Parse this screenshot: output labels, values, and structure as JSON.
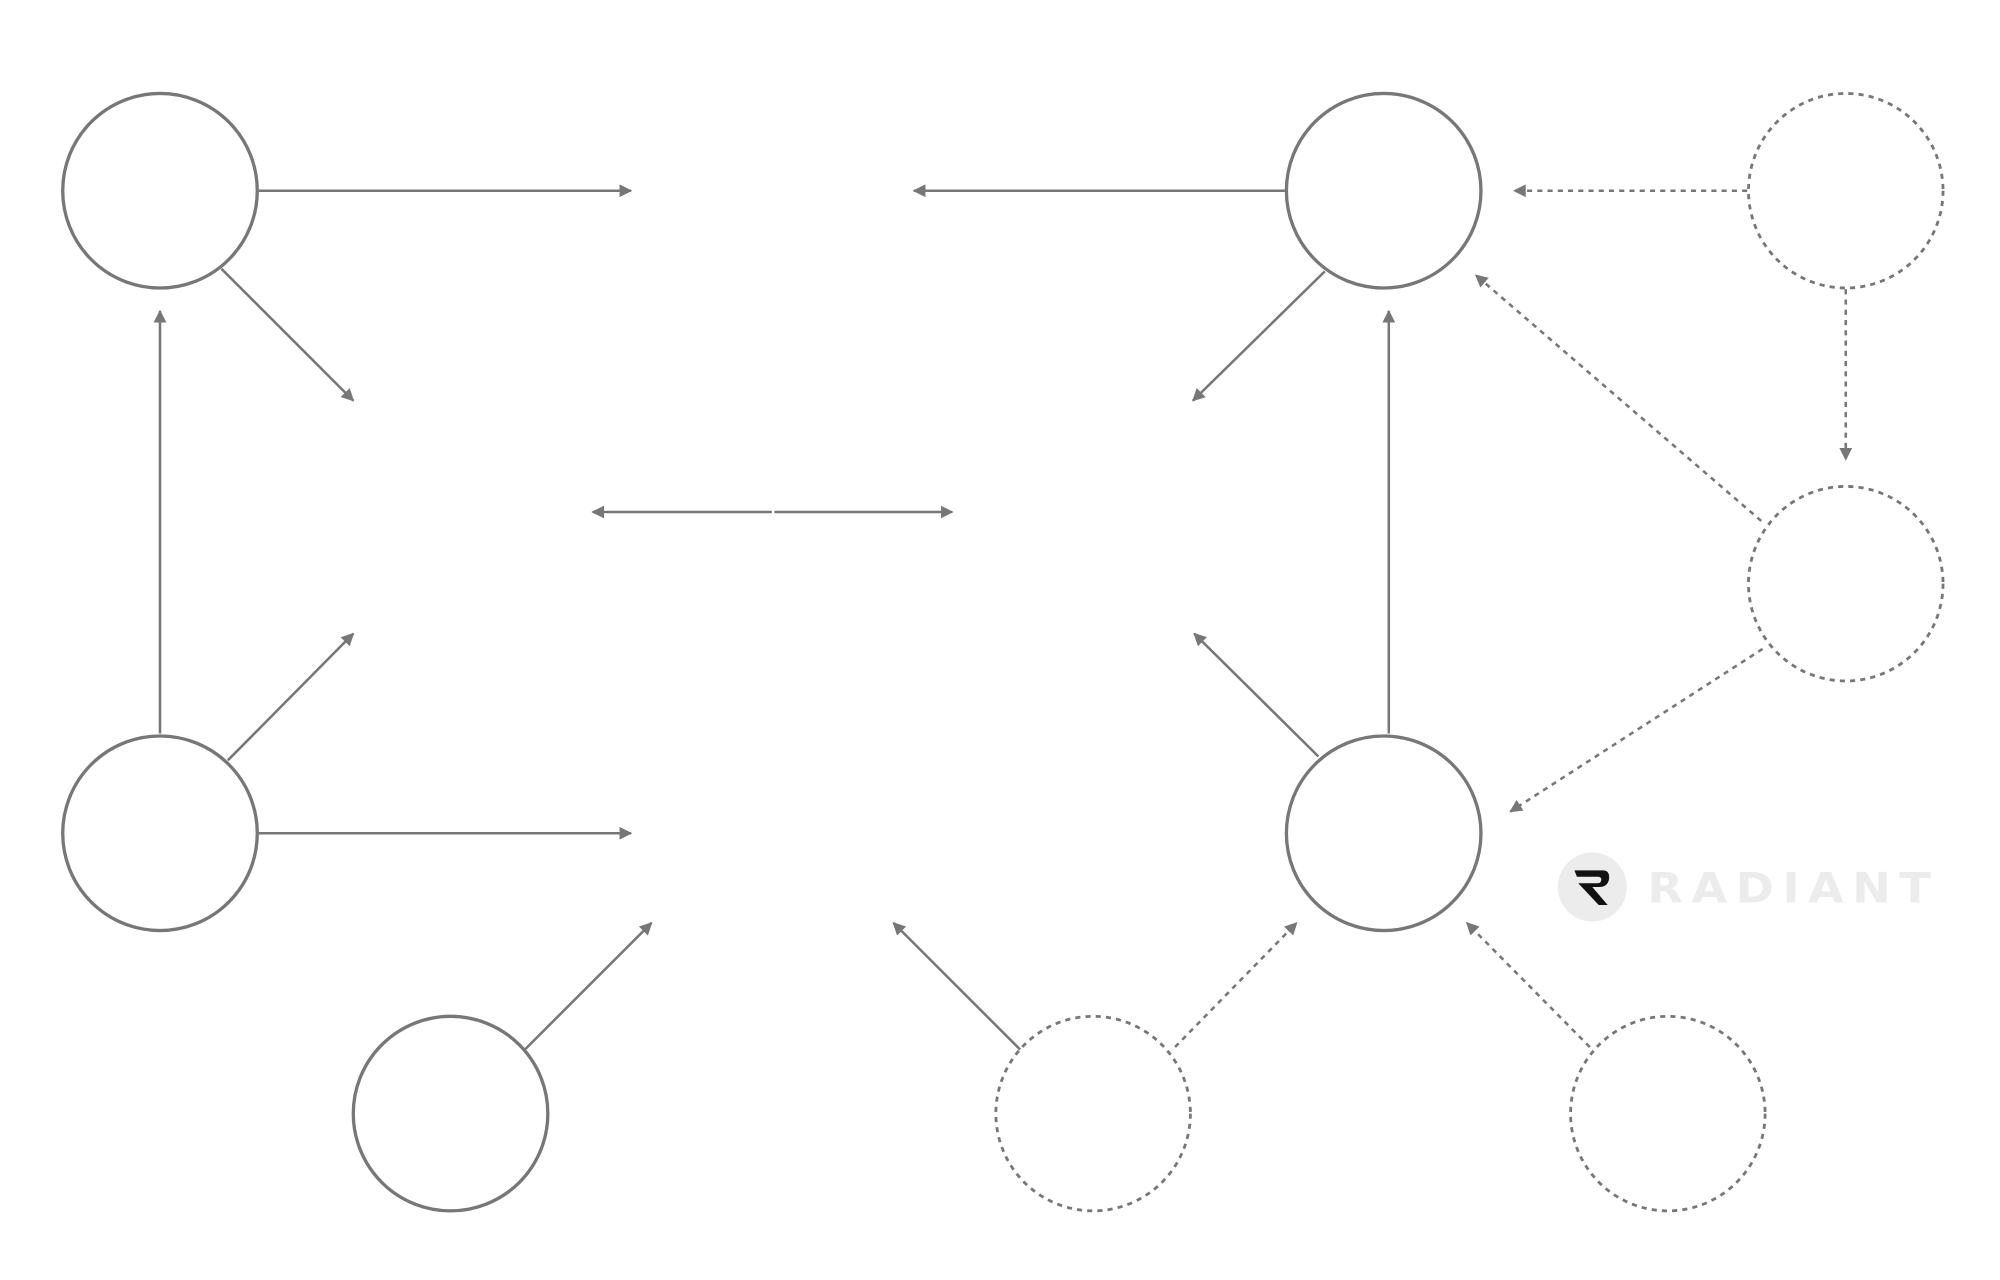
{
  "colors": {
    "stroke": "#777777",
    "logo_circle": "#ececec",
    "logo_mark": "#111111",
    "logo_text": "#ececec",
    "background": "#ffffff"
  },
  "logo": {
    "text": "RADIANT",
    "icon": "radiant-r-logo-icon"
  },
  "diagram": {
    "nodes": [
      {
        "id": "A",
        "style": "solid"
      },
      {
        "id": "B",
        "style": "solid"
      },
      {
        "id": "C",
        "style": "solid"
      },
      {
        "id": "D",
        "style": "solid"
      },
      {
        "id": "E",
        "style": "solid"
      },
      {
        "id": "F",
        "style": "dashed"
      },
      {
        "id": "G",
        "style": "dashed"
      },
      {
        "id": "H",
        "style": "dashed"
      },
      {
        "id": "I",
        "style": "dashed"
      }
    ],
    "edges": [
      {
        "from": "A",
        "to": "top-left-target",
        "style": "solid"
      },
      {
        "from": "A",
        "to": "center-left-upper",
        "style": "solid"
      },
      {
        "from": "B",
        "to": "A",
        "style": "solid"
      },
      {
        "from": "B",
        "to": "center-left-lower",
        "style": "solid"
      },
      {
        "from": "B",
        "to": "bottom-left-target",
        "style": "solid"
      },
      {
        "from": "C",
        "to": "bottom-center-left",
        "style": "solid"
      },
      {
        "from": "D",
        "to": "top-right-target",
        "style": "solid"
      },
      {
        "from": "D",
        "to": "center-right-upper",
        "style": "solid"
      },
      {
        "from": "E",
        "to": "D",
        "style": "solid"
      },
      {
        "from": "E",
        "to": "center-right-lower",
        "style": "solid"
      },
      {
        "from": "H",
        "to": "bottom-center-right",
        "style": "solid"
      },
      {
        "from": "H",
        "to": "E",
        "style": "dashed"
      },
      {
        "from": "I",
        "to": "E",
        "style": "dashed"
      },
      {
        "from": "F",
        "to": "D",
        "style": "dashed"
      },
      {
        "from": "F",
        "to": "G",
        "style": "dashed"
      },
      {
        "from": "G",
        "to": "D",
        "style": "dashed"
      },
      {
        "from": "G",
        "to": "E",
        "style": "dashed"
      },
      {
        "from": "center",
        "to": "center-left",
        "style": "solid"
      },
      {
        "from": "center",
        "to": "center-right",
        "style": "solid"
      }
    ]
  }
}
